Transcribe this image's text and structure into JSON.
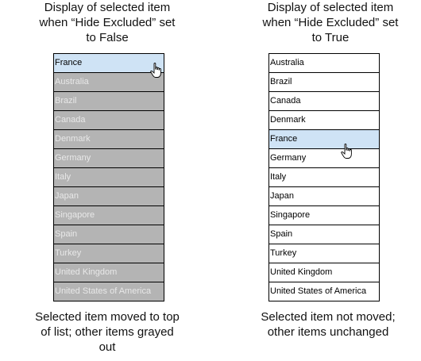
{
  "left_panel": {
    "title": "Display of selected item\nwhen  “Hide Excluded” set\nto False",
    "items": [
      {
        "label": "France",
        "state": "selected"
      },
      {
        "label": "Australia",
        "state": "grayed"
      },
      {
        "label": "Brazil",
        "state": "grayed"
      },
      {
        "label": "Canada",
        "state": "grayed"
      },
      {
        "label": "Denmark",
        "state": "grayed"
      },
      {
        "label": "Germany",
        "state": "grayed"
      },
      {
        "label": "Italy",
        "state": "grayed"
      },
      {
        "label": "Japan",
        "state": "grayed"
      },
      {
        "label": "Singapore",
        "state": "grayed"
      },
      {
        "label": "Spain",
        "state": "grayed"
      },
      {
        "label": "Turkey",
        "state": "grayed"
      },
      {
        "label": "United Kingdom",
        "state": "grayed"
      },
      {
        "label": "United States of America",
        "state": "grayed"
      }
    ],
    "caption": "Selected item moved to top\nof list; other items grayed\nout",
    "cursor_icon": "hand-pointer-icon"
  },
  "right_panel": {
    "title": "Display of selected item\nwhen “Hide Excluded” set\nto True",
    "items": [
      {
        "label": "Australia",
        "state": "normal"
      },
      {
        "label": "Brazil",
        "state": "normal"
      },
      {
        "label": "Canada",
        "state": "normal"
      },
      {
        "label": "Denmark",
        "state": "normal"
      },
      {
        "label": "France",
        "state": "selected"
      },
      {
        "label": "Germany",
        "state": "normal"
      },
      {
        "label": "Italy",
        "state": "normal"
      },
      {
        "label": "Japan",
        "state": "normal"
      },
      {
        "label": "Singapore",
        "state": "normal"
      },
      {
        "label": "Spain",
        "state": "normal"
      },
      {
        "label": "Turkey",
        "state": "normal"
      },
      {
        "label": "United Kingdom",
        "state": "normal"
      },
      {
        "label": "United States of America",
        "state": "normal"
      }
    ],
    "caption": "Selected item not moved;\nother items unchanged",
    "cursor_icon": "hand-pointer-icon"
  },
  "colors": {
    "selected_bg": "#cfe3f5",
    "grayed_bg": "#b4b4b4",
    "grayed_text": "#e8e8e8",
    "border": "#000000"
  }
}
